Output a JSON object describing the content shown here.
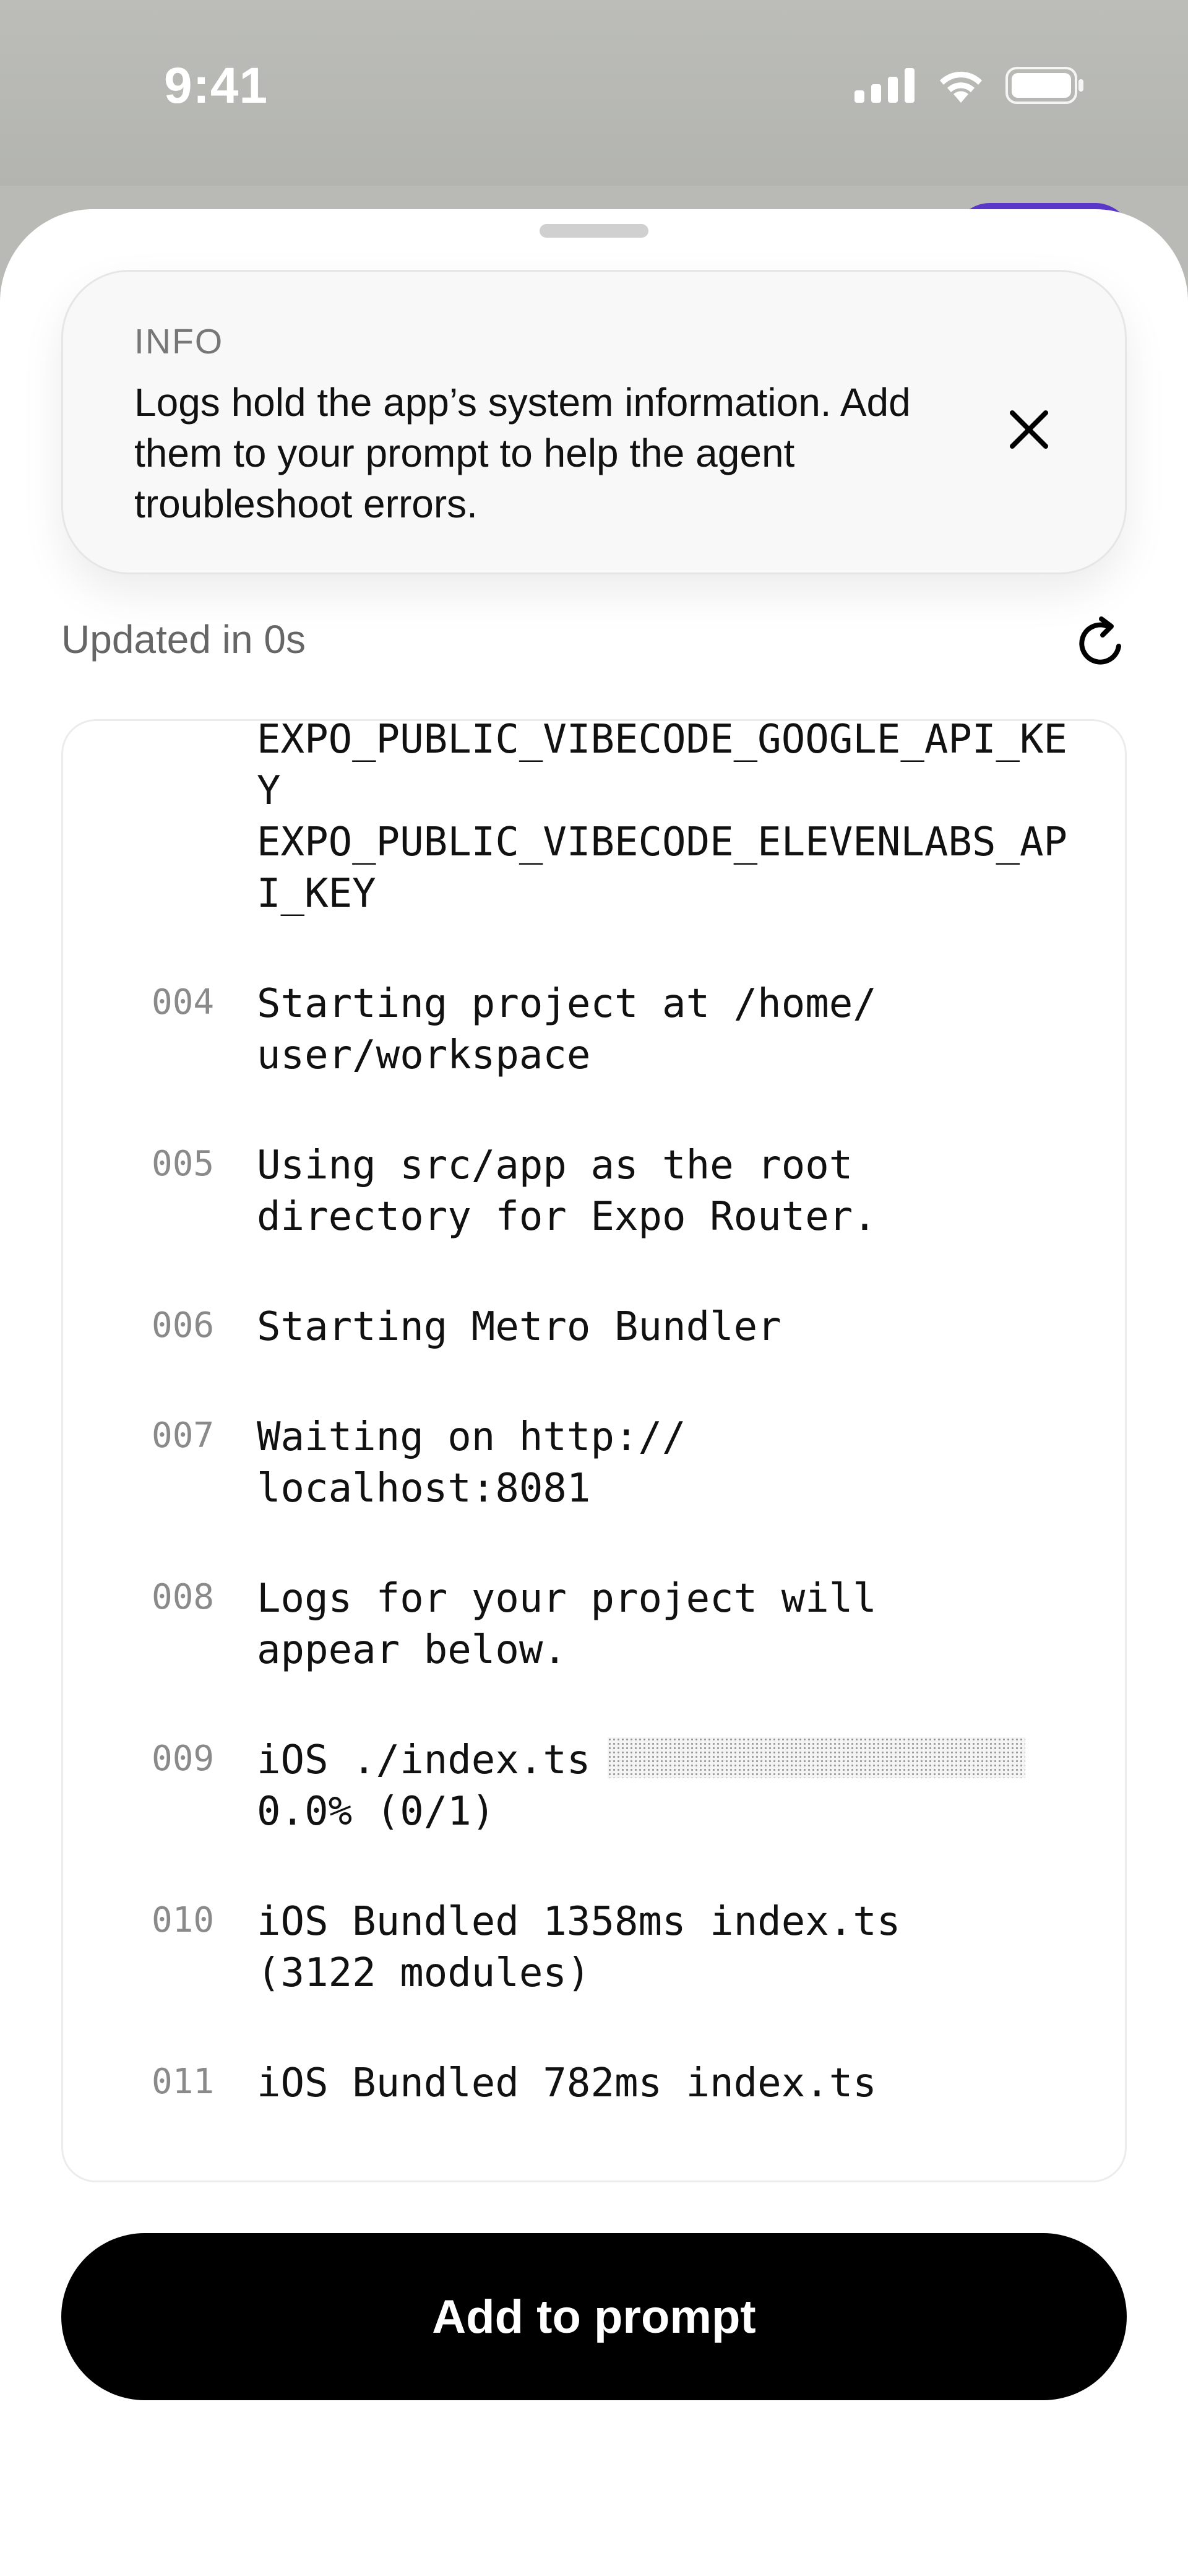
{
  "status_bar": {
    "time": "9:41"
  },
  "info": {
    "label": "INFO",
    "message": "Logs hold the app’s system information. Add them to your prompt to help the agent troubleshoot errors."
  },
  "updated_text": "Updated in 0s",
  "logs": [
    {
      "num": "",
      "text": "EXPO_PUBLIC_VIBECODE_GOOGLE_API_KEY\nEXPO_PUBLIC_VIBECODE_ELEVENLABS_API_KEY"
    },
    {
      "num": "004",
      "text": "Starting project at /home/\nuser/workspace"
    },
    {
      "num": "005",
      "text": "Using src/app as the root\ndirectory for Expo Router."
    },
    {
      "num": "006",
      "text": "Starting Metro Bundler"
    },
    {
      "num": "007",
      "text": "Waiting on http://\nlocalhost:8081"
    },
    {
      "num": "008",
      "text": "Logs for your project will\nappear below."
    },
    {
      "num": "009",
      "text_a": "iOS ./index.ts",
      "text_b": "0.0% (0/1)",
      "progress": 0.0
    },
    {
      "num": "010",
      "text": "iOS Bundled 1358ms index.ts\n(3122 modules)"
    },
    {
      "num": "011",
      "text": "iOS Bundled 782ms index.ts"
    }
  ],
  "cta_label": "Add to prompt"
}
